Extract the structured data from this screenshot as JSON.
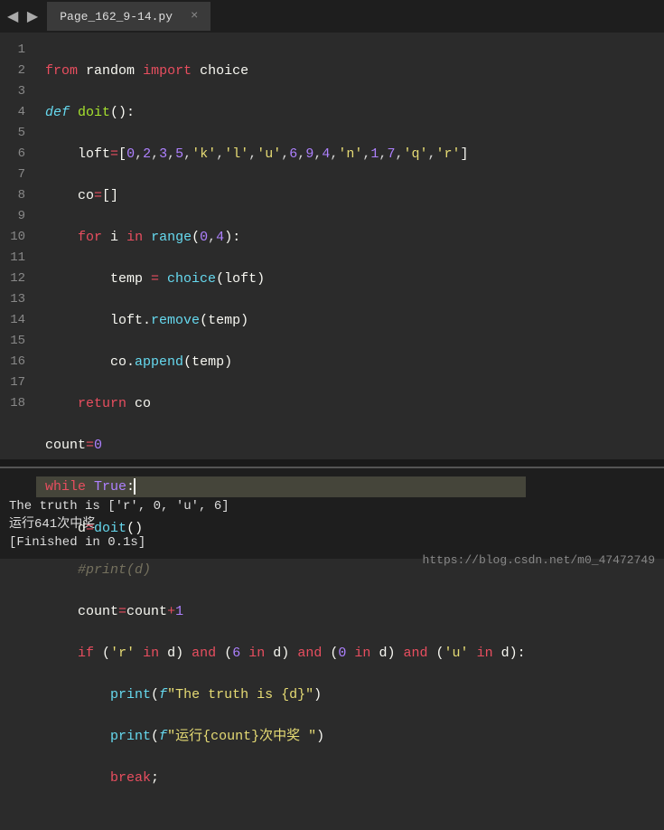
{
  "tab": {
    "filename": "Page_162_9-14.py"
  },
  "nav": {
    "arrows": "◀ ▶"
  },
  "lineNumbers": [
    "1",
    "2",
    "3",
    "4",
    "5",
    "6",
    "7",
    "8",
    "9",
    "10",
    "11",
    "12",
    "13",
    "14",
    "15",
    "16",
    "17",
    "18"
  ],
  "code": {
    "l1": {
      "from": "from",
      "mod": "random",
      "import": "import",
      "name": "choice"
    },
    "l2": {
      "def": "def",
      "fn": "doit",
      "p": "():"
    },
    "l3": {
      "var": "loft",
      "eq": "=",
      "lb": "[",
      "v": "0,2,3,5,'k','l','u',6,9,4,'n',1,7,'q','r'",
      "rb": "]"
    },
    "l4": {
      "var": "co",
      "eq": "=",
      "val": "[]"
    },
    "l5": {
      "for": "for",
      "i": "i",
      "in": "in",
      "range": "range",
      "args": "(0,4):"
    },
    "l6": {
      "temp": "temp",
      "eq": " = ",
      "choice": "choice",
      "arg": "(loft)"
    },
    "l7": {
      "obj": "loft",
      "dot": ".",
      "m": "remove",
      "arg": "(temp)"
    },
    "l8": {
      "obj": "co",
      "dot": ".",
      "m": "append",
      "arg": "(temp)"
    },
    "l9": {
      "ret": "return",
      "v": "co"
    },
    "l10": {
      "var": "count",
      "eq": "=",
      "val": "0"
    },
    "l11": {
      "while": "while",
      "true": "True",
      "colon": ":"
    },
    "l12": {
      "d": "d",
      "eq": "=",
      "fn": "doit",
      "p": "()"
    },
    "l13": {
      "c": "#print(d)"
    },
    "l14": {
      "var": "count",
      "eq": "=",
      "rhs": "count",
      "plus": "+",
      "one": "1"
    },
    "l15": {
      "if": "if",
      "open": "(",
      "s1": "'r'",
      "in1": "in",
      "d1": "d",
      "close": ")",
      "and": "and",
      "n6": "6",
      "n0": "0",
      "su": "'u'",
      "colon": ":"
    },
    "l16": {
      "print": "print",
      "op": "(",
      "f": "f",
      "s": "\"The truth is {d}\"",
      "cp": ")"
    },
    "l17": {
      "print": "print",
      "op": "(",
      "f": "f",
      "s": "\"运行{count}次中奖 \"",
      "cp": ")"
    },
    "l18": {
      "break": "break",
      "semi": ";"
    }
  },
  "output": {
    "l1": "The truth is ['r', 0, 'u', 6]",
    "l2": "运行641次中奖",
    "l3": "[Finished in 0.1s]"
  },
  "watermark": "https://blog.csdn.net/m0_47472749"
}
